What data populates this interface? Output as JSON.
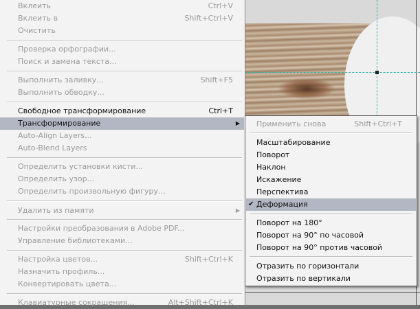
{
  "edit_menu": {
    "items": [
      {
        "label": "Вклеить",
        "shortcut": "Ctrl+V",
        "enabled": false
      },
      {
        "label": "Вклеить в",
        "shortcut": "Shift+Ctrl+V",
        "enabled": false
      },
      {
        "label": "Очистить",
        "shortcut": "",
        "enabled": false
      },
      {
        "label": "Проверка орфографии...",
        "shortcut": "",
        "enabled": false
      },
      {
        "label": "Поиск и замена текста...",
        "shortcut": "",
        "enabled": false
      },
      {
        "label": "Выполнить заливку...",
        "shortcut": "Shift+F5",
        "enabled": false
      },
      {
        "label": "Выполнить обводку...",
        "shortcut": "",
        "enabled": false
      },
      {
        "label": "Свободное трансформирование",
        "shortcut": "Ctrl+T",
        "enabled": true
      },
      {
        "label": "Трансформирование",
        "shortcut": "",
        "enabled": true,
        "submenu": true,
        "highlighted": true
      },
      {
        "label": "Auto-Align Layers...",
        "shortcut": "",
        "enabled": false
      },
      {
        "label": "Auto-Blend Layers",
        "shortcut": "",
        "enabled": false
      },
      {
        "label": "Определить установки кисти...",
        "shortcut": "",
        "enabled": false
      },
      {
        "label": "Определить узор...",
        "shortcut": "",
        "enabled": false
      },
      {
        "label": "Определить произвольную фигуру...",
        "shortcut": "",
        "enabled": false
      },
      {
        "label": "Удалить из памяти",
        "shortcut": "",
        "enabled": false,
        "submenu": true
      },
      {
        "label": "Настройки преобразования в Adobe PDF...",
        "shortcut": "",
        "enabled": false
      },
      {
        "label": "Управление библиотеками...",
        "shortcut": "",
        "enabled": false
      },
      {
        "label": "Настройка цветов...",
        "shortcut": "Shift+Ctrl+K",
        "enabled": false
      },
      {
        "label": "Назначить профиль...",
        "shortcut": "",
        "enabled": false
      },
      {
        "label": "Конвертировать цвета...",
        "shortcut": "",
        "enabled": false
      },
      {
        "label": "Клавиатурные сокращения...",
        "shortcut": "Alt+Shift+Ctrl+K",
        "enabled": false
      }
    ]
  },
  "transform_submenu": {
    "items": [
      {
        "label": "Применить снова",
        "shortcut": "Shift+Ctrl+T",
        "enabled": false
      },
      {
        "label": "Масштабирование",
        "enabled": true
      },
      {
        "label": "Поворот",
        "enabled": true
      },
      {
        "label": "Наклон",
        "enabled": true
      },
      {
        "label": "Искажение",
        "enabled": true
      },
      {
        "label": "Перспектива",
        "enabled": true
      },
      {
        "label": "Деформация",
        "enabled": true,
        "checked": true,
        "highlighted": true
      },
      {
        "label": "Поворот на 180°",
        "enabled": true
      },
      {
        "label": "Поворот на 90° по часовой",
        "enabled": true
      },
      {
        "label": "Поворот на 90° против часовой",
        "enabled": true
      },
      {
        "label": "Отразить по горизонтали",
        "enabled": true
      },
      {
        "label": "Отразить по вертикали",
        "enabled": true
      }
    ]
  },
  "icons": {
    "submenu_arrow": "triangle-right-icon",
    "check": "checkmark-icon"
  }
}
